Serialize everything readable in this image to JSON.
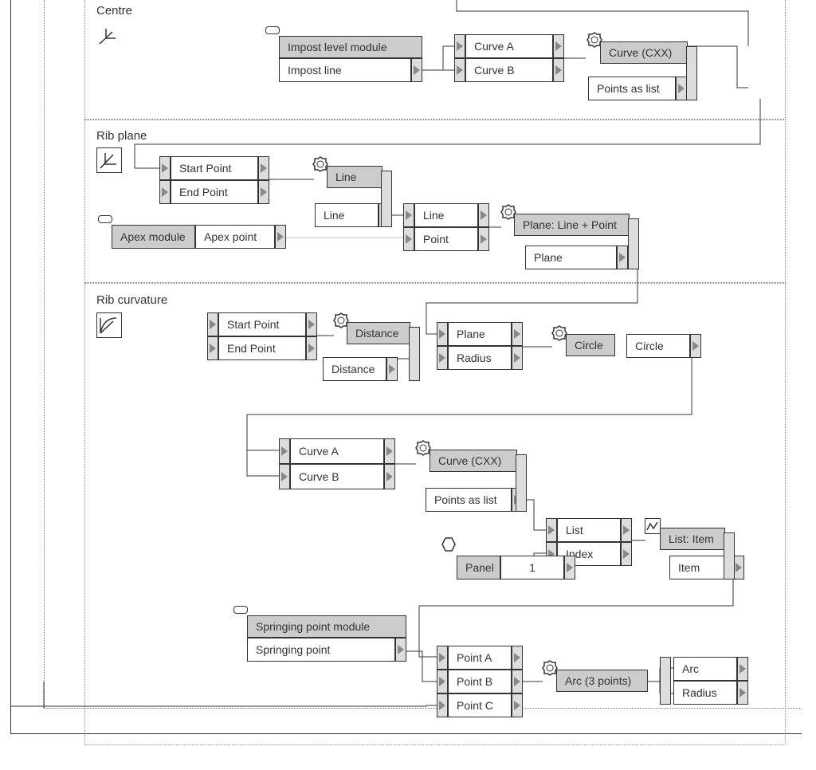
{
  "sections": {
    "centre": "Centre",
    "rib_plane": "Rib plane",
    "rib_curvature": "Rib curvature"
  },
  "nodes": {
    "impost_module": {
      "header": "Impost level module",
      "out": "Impost line"
    },
    "curve_pair1": {
      "a": "Curve A",
      "b": "Curve B"
    },
    "curve_cxx1": {
      "header": "Curve (CXX)",
      "out": "Points as list"
    },
    "start_end1": {
      "a": "Start Point",
      "b": "End Point"
    },
    "line_node": {
      "header": "Line",
      "out": "Line"
    },
    "apex_module": {
      "header": "Apex module",
      "out": "Apex point"
    },
    "line_point": {
      "a": "Line",
      "b": "Point"
    },
    "plane_lp": {
      "header": "Plane: Line + Point",
      "out": "Plane"
    },
    "start_end2": {
      "a": "Start Point",
      "b": "End Point"
    },
    "distance_node": {
      "header": "Distance",
      "out": "Distance"
    },
    "plane_radius": {
      "a": "Plane",
      "b": "Radius"
    },
    "circle_node": {
      "header": "Circle",
      "out": "Circle"
    },
    "curve_pair2": {
      "a": "Curve A",
      "b": "Curve B"
    },
    "curve_cxx2": {
      "header": "Curve (CXX)",
      "out": "Points as list"
    },
    "list_index": {
      "a": "List",
      "b": "Index"
    },
    "panel": {
      "header": "Panel",
      "val": "1"
    },
    "list_item": {
      "header": "List: Item",
      "out": "Item"
    },
    "springing": {
      "header": "Springing point module",
      "out": "Springing point"
    },
    "points_abc": {
      "a": "Point A",
      "b": "Point B",
      "c": "Point C"
    },
    "arc3": {
      "header": "Arc (3 points)",
      "a": "Arc",
      "b": "Radius"
    }
  }
}
